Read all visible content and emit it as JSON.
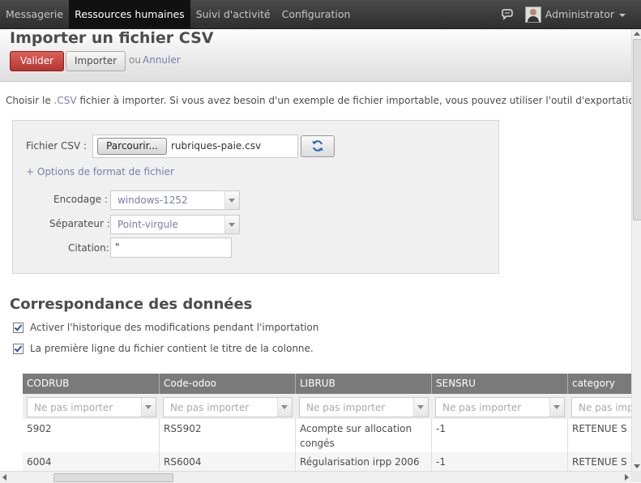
{
  "topbar": {
    "menu": [
      "Messagerie",
      "Ressources humaines",
      "Suivi d'activité",
      "Configuration"
    ],
    "active_index": 1,
    "user": "Administrator"
  },
  "control_panel": {
    "title": "Importer un fichier CSV",
    "validate_label": "Valider",
    "import_label": "Importer",
    "or_label": "ou",
    "cancel_label": "Annuler"
  },
  "intro": {
    "before": "Choisir le ",
    "link": ".CSV",
    "after": " fichier à importer. Si vous avez besoin d'un exemple de fichier importable, vous pouvez utiliser l'outil d'exportation pour"
  },
  "file_options": {
    "file_label": "Fichier CSV :",
    "browse_label": "Parcourir...",
    "file_name": "rubriques-paie.csv",
    "options_link": "+ Options de format de fichier",
    "encoding_label": "Encodage :",
    "encoding_value": "windows-1252",
    "separator_label": "Séparateur :",
    "separator_value": "Point-virgule",
    "quote_label": "Citation:",
    "quote_value": "\""
  },
  "mapping": {
    "title": "Correspondance des données",
    "track_history_label": "Activer l'historique des modifications pendant l'importation",
    "track_history_checked": true,
    "headers_label": "La première ligne du fichier contient le titre de la colonne.",
    "headers_checked": true
  },
  "table": {
    "columns": [
      "CODRUB",
      "Code-odoo",
      "LIBRUB",
      "SENSRU",
      "category"
    ],
    "placeholder": "Ne pas importer",
    "rows": [
      [
        "5902",
        "RS5902",
        "Acompte sur allocation congés",
        "-1",
        "RETENUE S"
      ],
      [
        "6004",
        "RS6004",
        "Régularisation irpp 2006",
        "-1",
        "RETENUE S"
      ]
    ]
  },
  "colors": {
    "topbar": "#2e2e2e",
    "active_menu": "#111111",
    "primary_button": "#b33630",
    "link": "#7c7bad",
    "table_header": "#7a7a7a"
  }
}
